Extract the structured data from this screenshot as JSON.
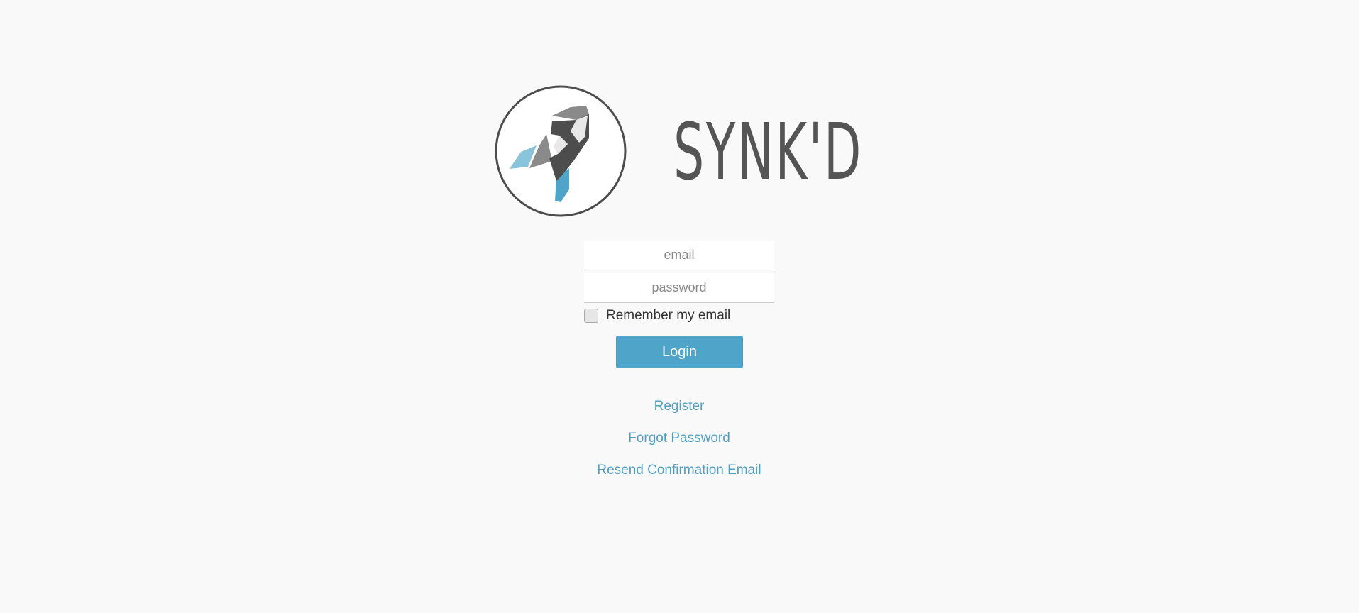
{
  "brand": {
    "name": "SYNK'D",
    "colors": {
      "wordmark": "#555555",
      "accent": "#4fa4c9",
      "accent_light": "#8ac4da",
      "dark_gray": "#4d4d4d",
      "mid_gray": "#8a8a8a",
      "light_gray": "#e8e8e8"
    },
    "logo_icon": "rocket-icon"
  },
  "form": {
    "email_placeholder": "email",
    "email_value": "",
    "password_placeholder": "password",
    "password_value": "",
    "remember_label": "Remember my email",
    "remember_checked": false,
    "login_label": "Login"
  },
  "links": {
    "register": "Register",
    "forgot_password": "Forgot Password",
    "resend_confirmation": "Resend Confirmation Email"
  }
}
